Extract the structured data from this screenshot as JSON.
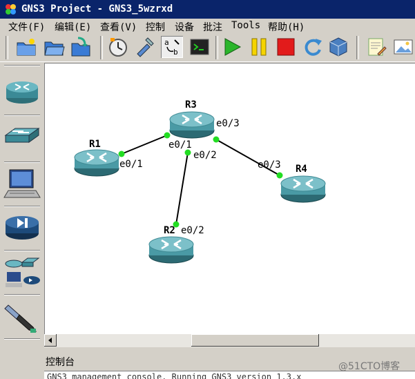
{
  "window": {
    "title": "GNS3 Project - GNS3_5wzrxd"
  },
  "menu": {
    "items": [
      "文件(F)",
      "编辑(E)",
      "查看(V)",
      "控制",
      "设备",
      "批注",
      "Tools",
      "帮助(H)"
    ]
  },
  "toolbar": {
    "icons": [
      "new-project-icon",
      "open-project-icon",
      "save-project-icon",
      "snapshot-clock-icon",
      "preferences-icon",
      "show-interface-labels-icon",
      "console-all-icon",
      "start-all-icon",
      "suspend-all-icon",
      "stop-all-icon",
      "reload-all-icon",
      "virtualbox-icon",
      "add-note-icon",
      "insert-picture-icon"
    ]
  },
  "device_panel": {
    "items": [
      "routers-icon",
      "switches-icon",
      "end-devices-icon",
      "security-devices-icon",
      "all-devices-icon",
      "add-link-icon"
    ]
  },
  "topology": {
    "routers": [
      {
        "name": "R1"
      },
      {
        "name": "R2"
      },
      {
        "name": "R3"
      },
      {
        "name": "R4"
      }
    ],
    "links": [
      {
        "a_label": "e0/1",
        "b_label": "e0/1"
      },
      {
        "a_label": "e0/2",
        "b_label": "e0/2"
      },
      {
        "a_label": "e0/3",
        "b_label": "e0/3"
      }
    ]
  },
  "console": {
    "title": "控制台",
    "text": "GNS3 management console. Running GNS3 version 1.3.x"
  },
  "watermark": "@51CTO博客",
  "colors": {
    "titlebar": "#0a246a",
    "port_ok": "#22dd22",
    "router_body": "#4a9aa5"
  }
}
